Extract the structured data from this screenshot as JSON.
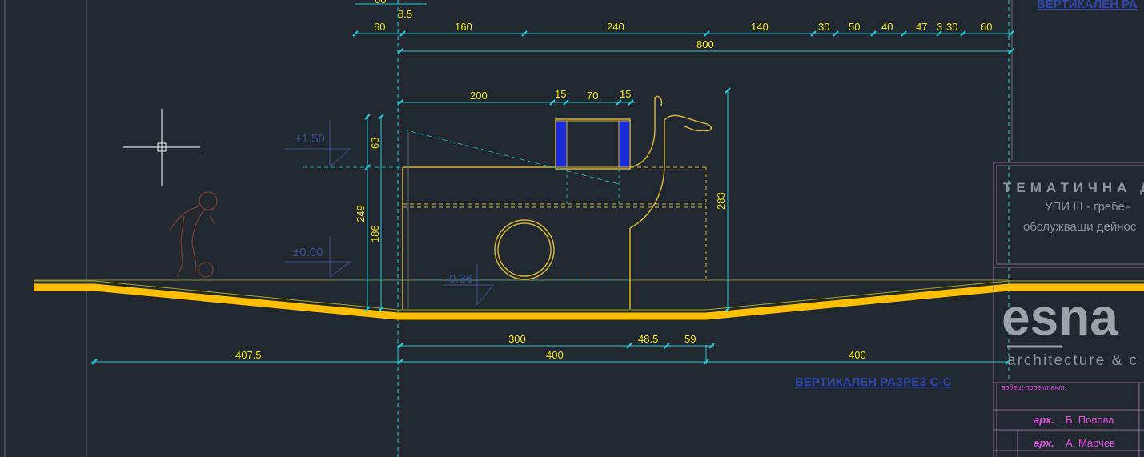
{
  "drawing": {
    "section_title": "ВЕРТИКАЛЕН РАЗРЕЗ С-С",
    "section_title_top": "ВЕРТИКАЛЕН РА",
    "levels": {
      "level_plus": "+1.50",
      "level_zero": "±0.00",
      "level_minus": "-0.36"
    },
    "dims_top": {
      "small_a": "60",
      "small_b": "8.5",
      "chain": [
        "60",
        "160",
        "240",
        "140",
        "30",
        "50",
        "40",
        "47",
        "3",
        "30",
        "60"
      ],
      "total": "800"
    },
    "dims_object": {
      "a": "200",
      "b": "15",
      "c": "70",
      "d": "15"
    },
    "dims_vertical": {
      "v63": "63",
      "v249": "249",
      "v186": "186",
      "v283": "283"
    },
    "dims_bottom": {
      "row1": [
        "300",
        "48.5",
        "59"
      ],
      "row2": [
        "407.5",
        "400",
        "400"
      ]
    }
  },
  "title_block": {
    "heading": "ТЕМАТИЧНА ДЕ",
    "line1": "УПИ III - гребен",
    "line2": "обслужващи дейнос",
    "logo": "esna",
    "logo_sub": "architecture & c",
    "lead_label": "водещ проектант:",
    "people": [
      {
        "title": "арх.",
        "name": "Б. Попова"
      },
      {
        "title": "арх.",
        "name": "А. Марчев"
      }
    ]
  },
  "colors": {
    "background": "#212830",
    "dimension": "#22c8d8",
    "dimension_text": "#f2e600",
    "ground": "#ffbf00",
    "object": "#d4b238",
    "window_glass": "#1a2bd8",
    "level_marks": "#3b4f96",
    "annotation": "#2f47a8",
    "title_block": "#8b919a"
  }
}
